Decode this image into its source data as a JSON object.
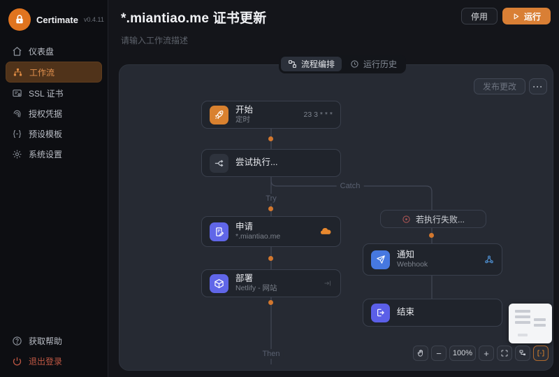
{
  "app": {
    "name": "Certimate",
    "version": "v0.4.11"
  },
  "sidebar": {
    "items": [
      {
        "label": "仪表盘",
        "icon": "home-icon",
        "active": false
      },
      {
        "label": "工作流",
        "icon": "workflow-icon",
        "active": true
      },
      {
        "label": "SSL 证书",
        "icon": "certificate-icon",
        "active": false
      },
      {
        "label": "授权凭据",
        "icon": "credentials-icon",
        "active": false
      },
      {
        "label": "预设模板",
        "icon": "template-icon",
        "active": false
      },
      {
        "label": "系统设置",
        "icon": "settings-icon",
        "active": false
      }
    ],
    "footer": [
      {
        "label": "获取帮助",
        "icon": "help-icon"
      },
      {
        "label": "退出登录",
        "icon": "logout-icon"
      }
    ]
  },
  "header": {
    "title": "*.miantiao.me 证书更新",
    "description": "请输入工作流描述",
    "disable_button": "停用",
    "run_button": "运行"
  },
  "tabs": {
    "editor": "流程编排",
    "history": "运行历史"
  },
  "canvas": {
    "publish_button": "发布更改",
    "more_button": "···",
    "branch_labels": {
      "try": "Try",
      "catch": "Catch",
      "then": "Then"
    },
    "nodes": {
      "start": {
        "title": "开始",
        "subtitle": "定时",
        "meta": "23 3 * * *"
      },
      "try_block": {
        "title": "尝试执行..."
      },
      "apply": {
        "title": "申请",
        "subtitle": "*.miantiao.me"
      },
      "deploy": {
        "title": "部署",
        "subtitle": "Netlify - 网站"
      },
      "on_failure": {
        "title": "若执行失败..."
      },
      "notify": {
        "title": "通知",
        "subtitle": "Webhook"
      },
      "end": {
        "title": "结束"
      }
    },
    "toolbar": {
      "zoom_out": "−",
      "zoom_level": "100%",
      "zoom_in": "+"
    }
  },
  "colors": {
    "accent_orange": "#d9822f",
    "sidebar_active_bg": "#50331a",
    "node_indigo": "#6066e8",
    "notify_blue": "#4678e0",
    "failure_red": "#a85454",
    "cloudflare_orange": "#e8882e",
    "webhook_blue": "#4e8fd0",
    "canvas_bg": "#262a33"
  }
}
